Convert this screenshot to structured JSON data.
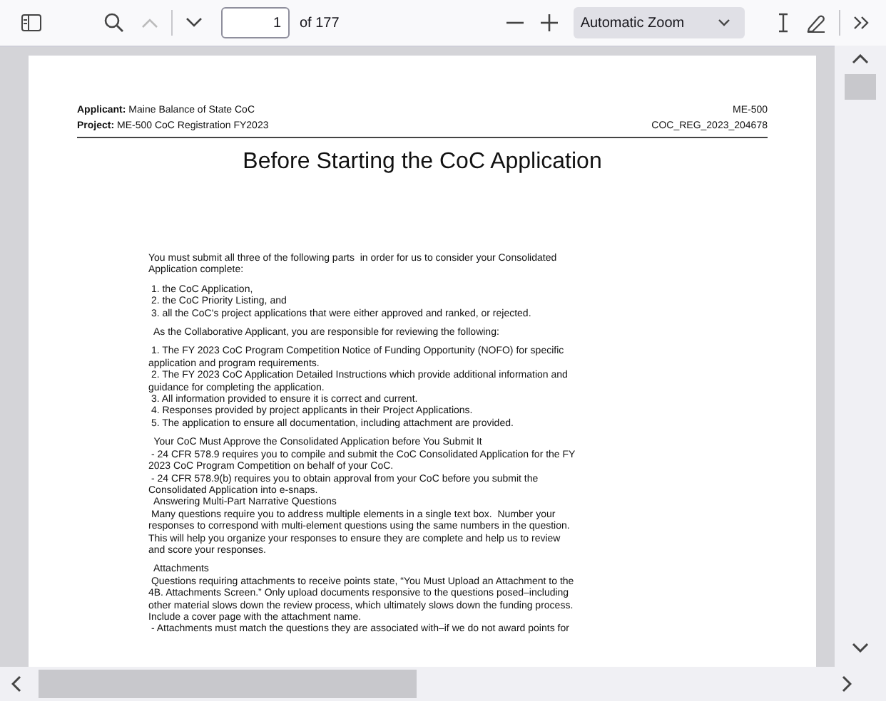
{
  "toolbar": {
    "page_number": "1",
    "page_count": "of 177",
    "zoom": "Automatic Zoom",
    "nav_buttons": [
      {
        "kind": "previous",
        "disabled": true
      },
      {
        "kind": "next",
        "disabled": false
      }
    ]
  },
  "document": {
    "header": {
      "applicant": "**Applicant:** Maine Balance of State CoC",
      "code": "ME-500",
      "project": "**Project:** ME-500 CoC Registration FY2023",
      "registration_id": "COC_REG_2023_204678"
    },
    "title": "Before Starting the CoC Application",
    "blocks": [
      {
        "lines": [
          "You must submit all three of the following parts  in order for us to consider your Consolidated",
          "Application complete:"
        ]
      },
      {
        "lines": [
          " 1. the CoC Application,",
          " 2. the CoC Priority Listing, and",
          " 3. all the CoC's project applications that were either approved and ranked, or rejected."
        ]
      },
      {
        "lines": [
          "  As the Collaborative Applicant, you are responsible for reviewing the following:"
        ]
      },
      {
        "lines": [
          " 1. The FY 2023 CoC Program Competition Notice of Funding Opportunity (NOFO) for specific",
          "application and program requirements.",
          " 2. The FY 2023 CoC Application Detailed Instructions which provide additional information and",
          "guidance for completing the application.",
          " 3. All information provided to ensure it is correct and current.",
          " 4. Responses provided by project applicants in their Project Applications.",
          " 5. The application to ensure all documentation, including attachment are provided."
        ]
      },
      {
        "lines": [
          "  Your CoC Must Approve the Consolidated Application before You Submit It",
          " - 24 CFR 578.9 requires you to compile and submit the CoC Consolidated Application for the FY",
          "2023 CoC Program Competition on behalf of your CoC.",
          " - 24 CFR 578.9(b) requires you to obtain approval from your CoC before you submit the",
          "Consolidated Application into e-snaps.",
          "  Answering Multi-Part Narrative Questions",
          " Many questions require you to address multiple elements in a single text box.  Number your",
          "responses to correspond with multi-element questions using the same numbers in the question.",
          "This will help you organize your responses to ensure they are complete and help us to review",
          "and score your responses."
        ]
      },
      {
        "lines": [
          "  Attachments",
          " Questions requiring attachments to receive points state, “You Must Upload an Attachment to the",
          "4B. Attachments Screen.” Only upload documents responsive to the questions posed–including",
          "other material slows down the review process, which ultimately slows down the funding process.",
          "Include a cover page with the attachment name.",
          " - Attachments must match the questions they are associated with–if we do not award points for"
        ]
      }
    ]
  }
}
